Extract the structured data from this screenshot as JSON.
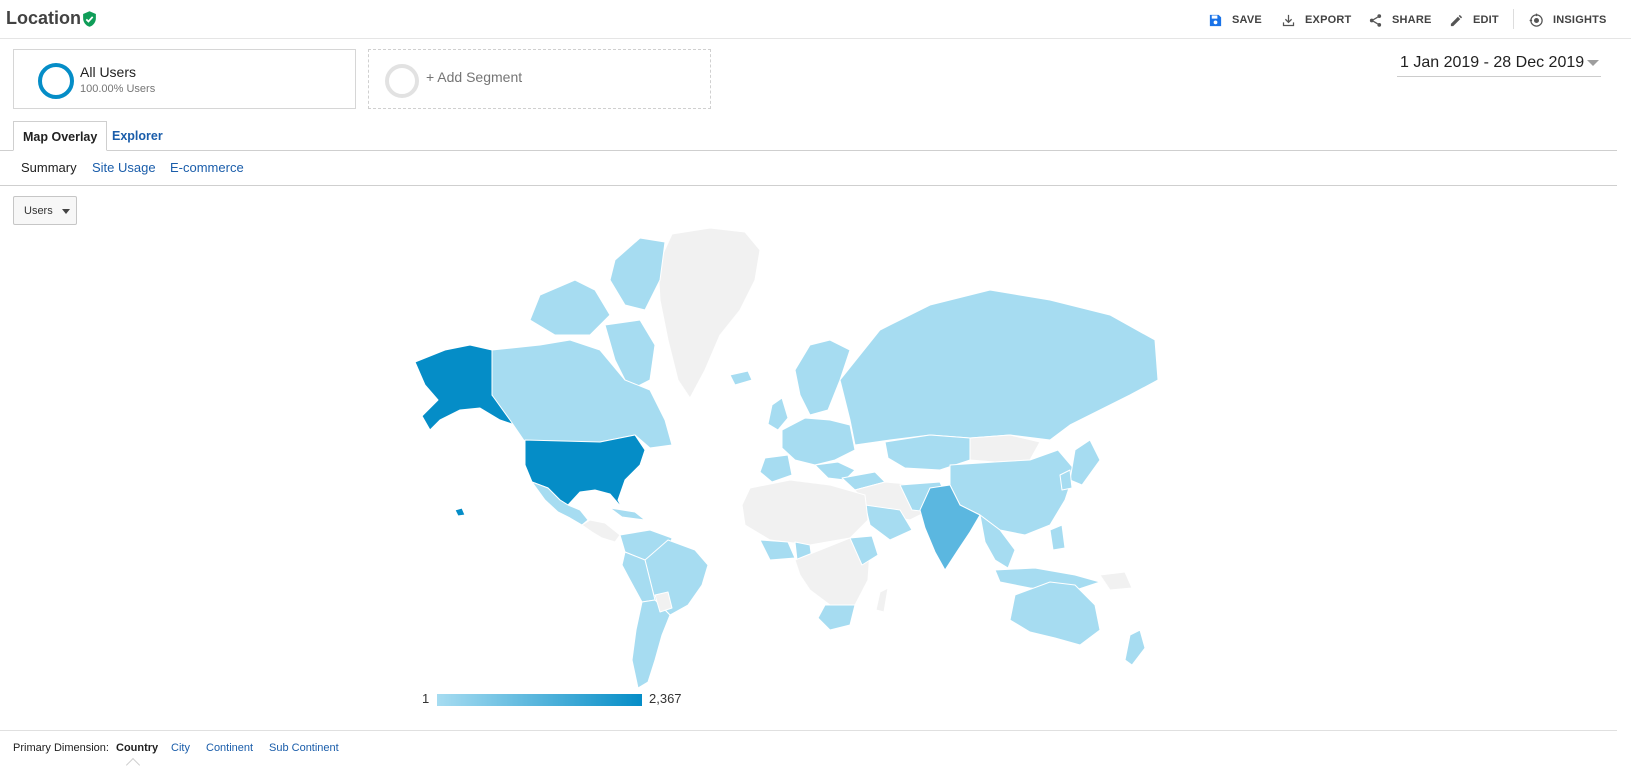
{
  "header": {
    "title": "Location",
    "toolbar": {
      "save": "SAVE",
      "export": "EXPORT",
      "share": "SHARE",
      "edit": "EDIT",
      "insights": "INSIGHTS"
    }
  },
  "segments": {
    "all_users": {
      "title": "All Users",
      "subtitle": "100.00% Users"
    },
    "add_segment": "+ Add Segment"
  },
  "date_range": "1 Jan 2019 - 28 Dec 2019",
  "tabs": [
    {
      "label": "Map Overlay",
      "active": true
    },
    {
      "label": "Explorer",
      "active": false
    }
  ],
  "subtabs": [
    {
      "label": "Summary",
      "active": true
    },
    {
      "label": "Site Usage",
      "active": false
    },
    {
      "label": "E-commerce",
      "active": false
    }
  ],
  "metric_select": {
    "value": "Users"
  },
  "map": {
    "legend": {
      "min": "1",
      "max": "2,367"
    },
    "colors": {
      "high": "#058dc7",
      "mid": "#5bb7e0",
      "low": "#a6dcf1",
      "none": "#f1f1f1"
    }
  },
  "primary_dimension": {
    "label": "Primary Dimension:",
    "items": [
      {
        "label": "Country",
        "active": true
      },
      {
        "label": "City",
        "active": false
      },
      {
        "label": "Continent",
        "active": false
      },
      {
        "label": "Sub Continent",
        "active": false
      }
    ]
  }
}
